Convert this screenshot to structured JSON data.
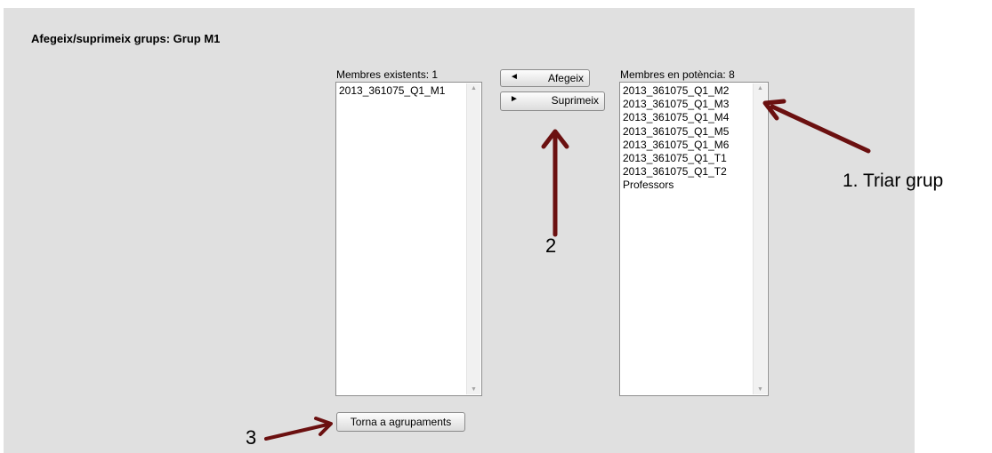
{
  "page": {
    "title": "Afegeix/suprimeix grups: Grup M1"
  },
  "existing": {
    "label": "Membres existents: 1",
    "options": [
      "2013_361075_Q1_M1"
    ]
  },
  "actions": {
    "add_icon": "◄",
    "add_label": "Afegeix",
    "remove_icon": "►",
    "remove_label": "Suprimeix"
  },
  "potential": {
    "label": "Membres en potència: 8",
    "options": [
      "2013_361075_Q1_M2",
      "2013_361075_Q1_M3",
      "2013_361075_Q1_M4",
      "2013_361075_Q1_M5",
      "2013_361075_Q1_M6",
      "2013_361075_Q1_T1",
      "2013_361075_Q1_T2",
      "Professors"
    ]
  },
  "back_button": {
    "label": "Torna a agrupaments"
  },
  "annotations": {
    "step1": "1. Triar grup",
    "step2": "2",
    "step3": "3",
    "arrow_color": "#6b1010"
  }
}
